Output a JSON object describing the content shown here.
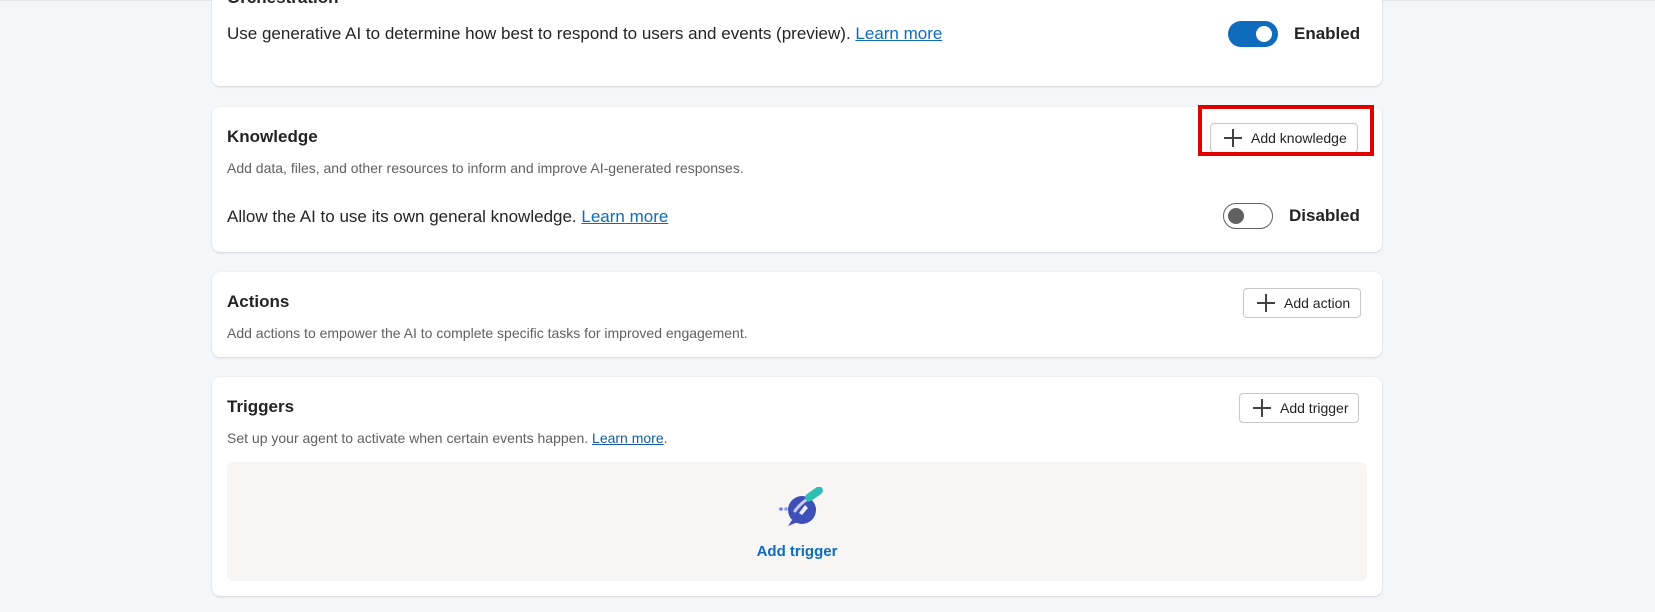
{
  "orchestration": {
    "title": "Orchestration",
    "text": "Use generative AI to determine how best to respond to users and events (preview).",
    "learn_more": "Learn more",
    "toggle_state": "on",
    "toggle_label": "Enabled"
  },
  "knowledge": {
    "title": "Knowledge",
    "description": "Add data, files, and other resources to inform and improve AI-generated responses.",
    "add_button": "Add knowledge",
    "general_text": "Allow the AI to use its own general knowledge.",
    "learn_more": "Learn more",
    "toggle_state": "off",
    "toggle_label": "Disabled"
  },
  "actions": {
    "title": "Actions",
    "description": "Add actions to empower the AI to complete specific tasks for improved engagement.",
    "add_button": "Add action"
  },
  "triggers": {
    "title": "Triggers",
    "description": "Set up your agent to activate when certain events happen.",
    "learn_more": "Learn more",
    "period": ".",
    "add_button": "Add trigger",
    "empty_cta": "Add trigger",
    "illustration_icon": "trigger-illustration-icon"
  },
  "colors": {
    "accent": "#0f6cbd",
    "highlight": "#e00000",
    "background": "#f3f7fa"
  }
}
